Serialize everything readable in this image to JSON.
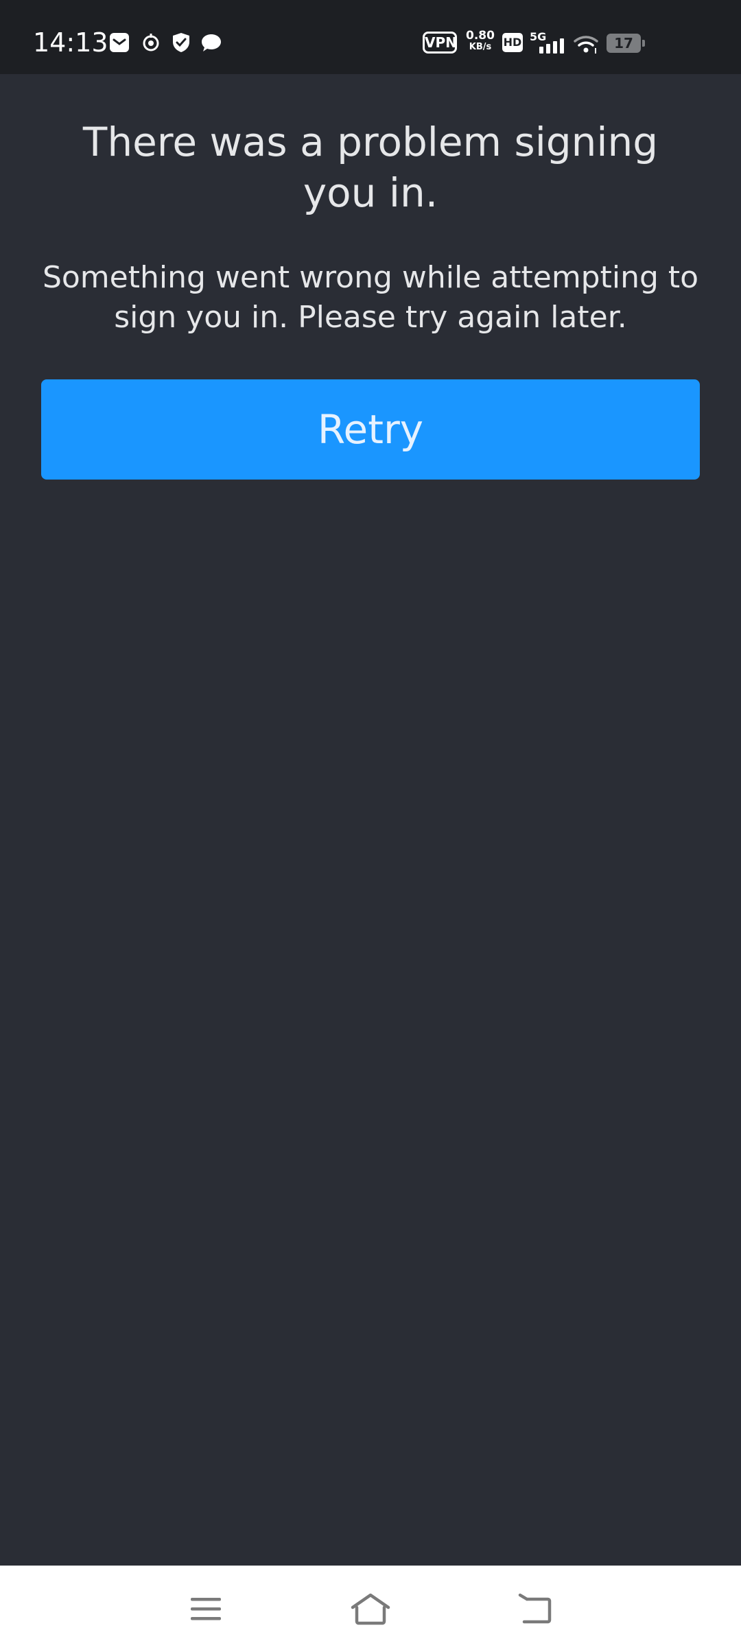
{
  "status_bar": {
    "time": "14:13",
    "notification_icons": [
      "mail-icon",
      "sync-icon",
      "shield-check-icon",
      "chat-bubble-icon"
    ],
    "vpn_label": "VPN",
    "speed_value": "0.80",
    "speed_unit": "KB/s",
    "hd_label": "HD",
    "network_label": "5G",
    "battery_level": "17"
  },
  "error": {
    "title": "There was a problem signing you in.",
    "message": "Something went wrong while attempting to sign you in. Please try again later."
  },
  "actions": {
    "retry_label": "Retry"
  },
  "nav_bar": {
    "items": [
      "menu-icon",
      "home-icon",
      "back-icon"
    ]
  },
  "colors": {
    "background": "#2a2d35",
    "status_bar": "#1d1f23",
    "accent": "#1a96ff",
    "text": "#e6e7e9"
  }
}
